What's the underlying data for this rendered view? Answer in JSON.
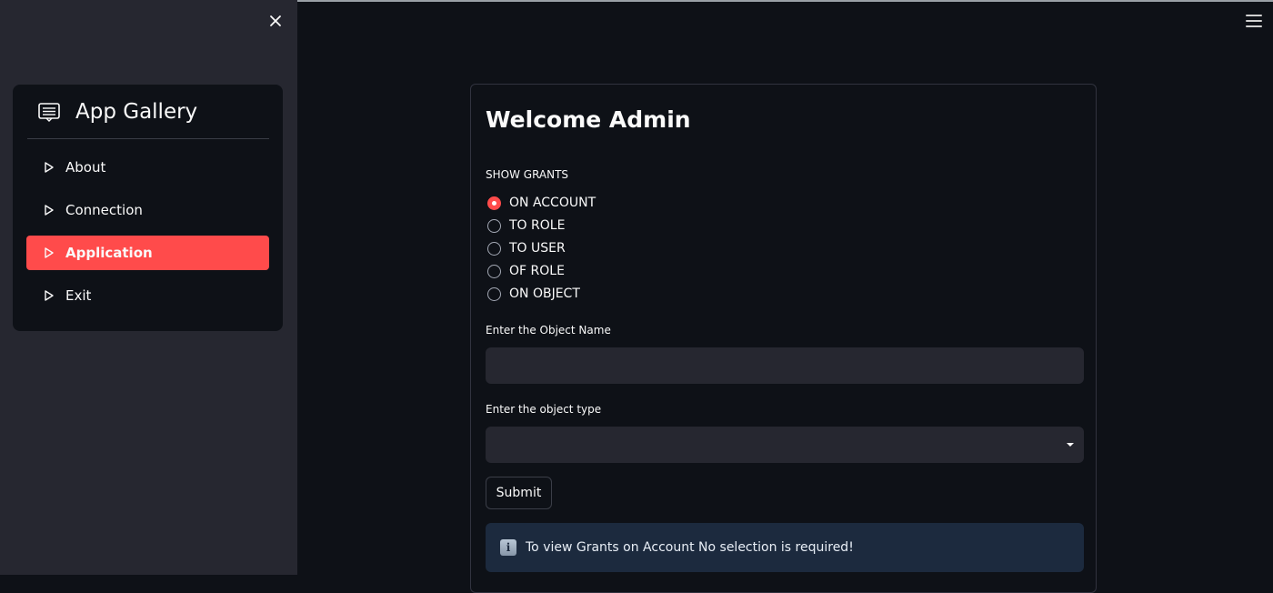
{
  "sidebar": {
    "app_title": "App Gallery",
    "items": [
      {
        "label": "About",
        "active": false
      },
      {
        "label": "Connection",
        "active": false
      },
      {
        "label": "Application",
        "active": true
      },
      {
        "label": "Exit",
        "active": false
      }
    ]
  },
  "main": {
    "title": "Welcome Admin",
    "show_grants_label": "SHOW GRANTS",
    "radio_options": [
      {
        "label": "ON ACCOUNT",
        "selected": true
      },
      {
        "label": "TO ROLE",
        "selected": false
      },
      {
        "label": "TO USER",
        "selected": false
      },
      {
        "label": "OF ROLE",
        "selected": false
      },
      {
        "label": "ON OBJECT",
        "selected": false
      }
    ],
    "object_name_label": "Enter the Object Name",
    "object_name_value": "",
    "object_type_label": "Enter the object type",
    "object_type_value": "",
    "submit_label": "Submit",
    "info_message": "To view Grants on Account No selection is required!"
  },
  "colors": {
    "accent": "#ff4b4b",
    "sidebar_bg": "#262730",
    "main_bg": "#0e1117",
    "info_bg": "#1c2a3e"
  },
  "icons": [
    "close-icon",
    "app-gallery-icon",
    "play-triangle-icon",
    "hamburger-menu-icon",
    "chevron-down-icon",
    "info-icon"
  ]
}
